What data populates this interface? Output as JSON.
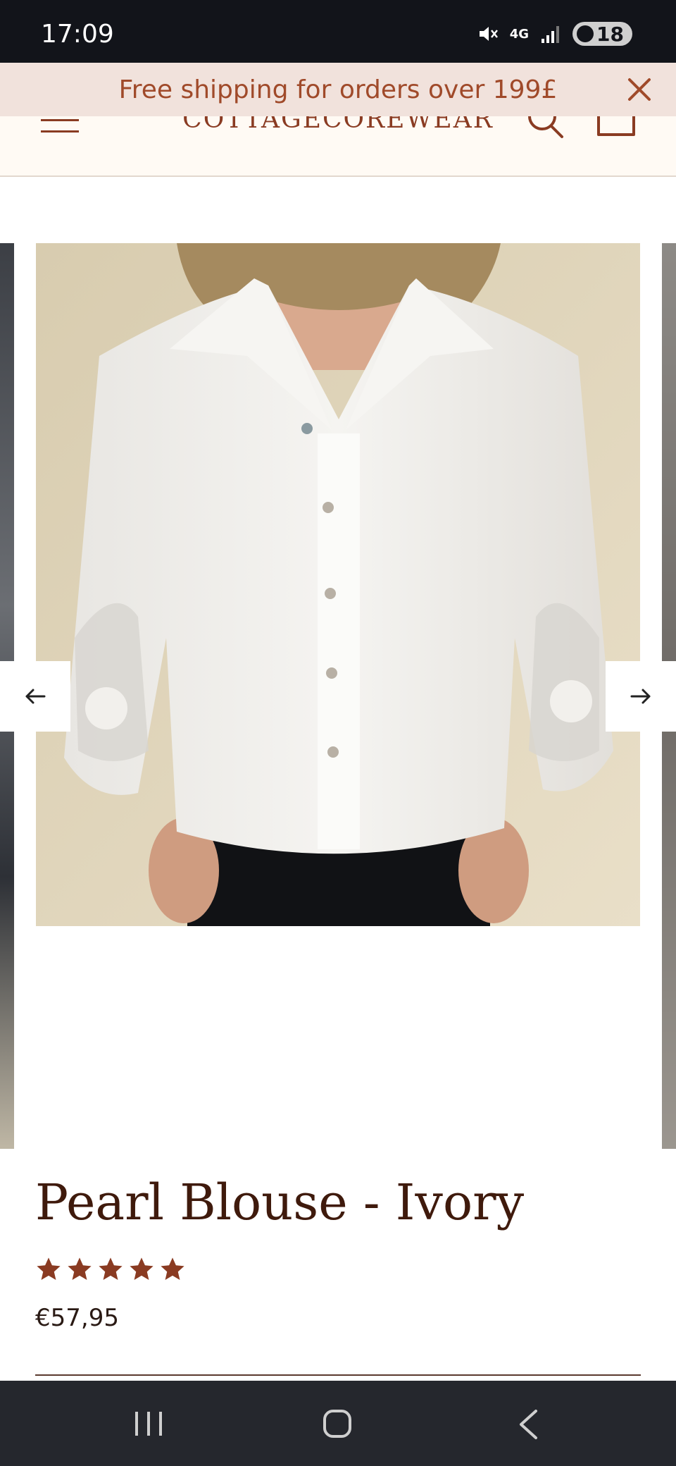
{
  "status_bar": {
    "time": "17:09",
    "network": "4G",
    "battery": "18"
  },
  "announcement": {
    "text": "Free shipping for orders over 199£",
    "close_icon": "close-icon"
  },
  "header": {
    "logo": "COTTAGECOREWEAR",
    "menu_icon": "menu-icon",
    "search_icon": "search-icon",
    "cart_icon": "cart-icon"
  },
  "gallery": {
    "prev_icon": "arrow-left-icon",
    "next_icon": "arrow-right-icon"
  },
  "product": {
    "title": "Pearl Blouse - Ivory",
    "rating": 5,
    "rating_max": 5,
    "price": "€57,95"
  },
  "colors": {
    "accent": "#a04a2a",
    "title": "#3f1a0c",
    "star": "#8a3b22",
    "announcement_bg": "#f1e2dc"
  }
}
